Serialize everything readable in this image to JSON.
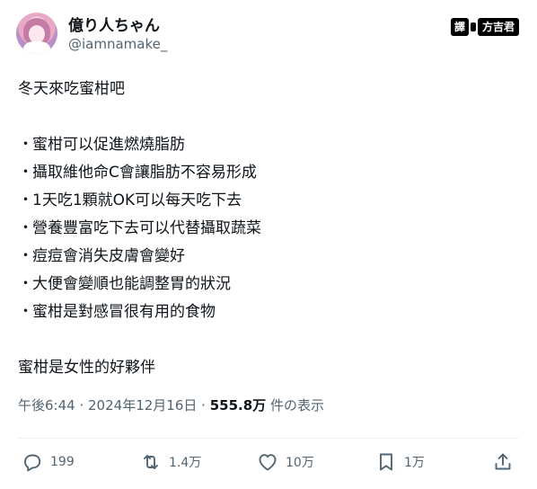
{
  "author": {
    "display_name": "億り人ちゃん",
    "handle": "@iamnamake_"
  },
  "badge": {
    "label": "譯",
    "name": "方吉君"
  },
  "tweet": {
    "title": "冬天來吃蜜柑吧",
    "bullets": [
      "蜜柑可以促進燃燒脂肪",
      "攝取維他命C會讓脂肪不容易形成",
      "1天吃1顆就OK可以每天吃下去",
      "營養豐富吃下去可以代替攝取蔬菜",
      "痘痘會消失皮膚會變好",
      "大便會變順也能調整胃的狀況",
      "蜜柑是對感冒很有用的食物"
    ],
    "closing": "蜜柑是女性的好夥伴"
  },
  "meta": {
    "time": "午後6:44",
    "date": "2024年12月16日",
    "views": "555.8万",
    "views_suffix": "件の表示"
  },
  "actions": {
    "reply_count": "199",
    "retweet_count": "1.4万",
    "like_count": "10万",
    "bookmark_count": "1万"
  },
  "icons": {
    "reply": "reply-icon",
    "retweet": "retweet-icon",
    "like": "heart-icon",
    "bookmark": "bookmark-icon",
    "share": "share-icon"
  }
}
